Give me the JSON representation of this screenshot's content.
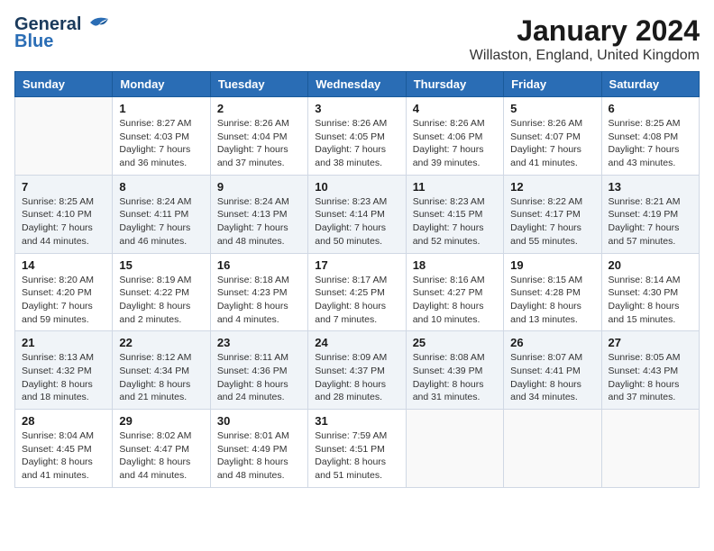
{
  "logo": {
    "line1": "General",
    "line2": "Blue"
  },
  "title": "January 2024",
  "location": "Willaston, England, United Kingdom",
  "days_of_week": [
    "Sunday",
    "Monday",
    "Tuesday",
    "Wednesday",
    "Thursday",
    "Friday",
    "Saturday"
  ],
  "weeks": [
    [
      {
        "day": "",
        "info": ""
      },
      {
        "day": "1",
        "info": "Sunrise: 8:27 AM\nSunset: 4:03 PM\nDaylight: 7 hours\nand 36 minutes."
      },
      {
        "day": "2",
        "info": "Sunrise: 8:26 AM\nSunset: 4:04 PM\nDaylight: 7 hours\nand 37 minutes."
      },
      {
        "day": "3",
        "info": "Sunrise: 8:26 AM\nSunset: 4:05 PM\nDaylight: 7 hours\nand 38 minutes."
      },
      {
        "day": "4",
        "info": "Sunrise: 8:26 AM\nSunset: 4:06 PM\nDaylight: 7 hours\nand 39 minutes."
      },
      {
        "day": "5",
        "info": "Sunrise: 8:26 AM\nSunset: 4:07 PM\nDaylight: 7 hours\nand 41 minutes."
      },
      {
        "day": "6",
        "info": "Sunrise: 8:25 AM\nSunset: 4:08 PM\nDaylight: 7 hours\nand 43 minutes."
      }
    ],
    [
      {
        "day": "7",
        "info": "Sunrise: 8:25 AM\nSunset: 4:10 PM\nDaylight: 7 hours\nand 44 minutes."
      },
      {
        "day": "8",
        "info": "Sunrise: 8:24 AM\nSunset: 4:11 PM\nDaylight: 7 hours\nand 46 minutes."
      },
      {
        "day": "9",
        "info": "Sunrise: 8:24 AM\nSunset: 4:13 PM\nDaylight: 7 hours\nand 48 minutes."
      },
      {
        "day": "10",
        "info": "Sunrise: 8:23 AM\nSunset: 4:14 PM\nDaylight: 7 hours\nand 50 minutes."
      },
      {
        "day": "11",
        "info": "Sunrise: 8:23 AM\nSunset: 4:15 PM\nDaylight: 7 hours\nand 52 minutes."
      },
      {
        "day": "12",
        "info": "Sunrise: 8:22 AM\nSunset: 4:17 PM\nDaylight: 7 hours\nand 55 minutes."
      },
      {
        "day": "13",
        "info": "Sunrise: 8:21 AM\nSunset: 4:19 PM\nDaylight: 7 hours\nand 57 minutes."
      }
    ],
    [
      {
        "day": "14",
        "info": "Sunrise: 8:20 AM\nSunset: 4:20 PM\nDaylight: 7 hours\nand 59 minutes."
      },
      {
        "day": "15",
        "info": "Sunrise: 8:19 AM\nSunset: 4:22 PM\nDaylight: 8 hours\nand 2 minutes."
      },
      {
        "day": "16",
        "info": "Sunrise: 8:18 AM\nSunset: 4:23 PM\nDaylight: 8 hours\nand 4 minutes."
      },
      {
        "day": "17",
        "info": "Sunrise: 8:17 AM\nSunset: 4:25 PM\nDaylight: 8 hours\nand 7 minutes."
      },
      {
        "day": "18",
        "info": "Sunrise: 8:16 AM\nSunset: 4:27 PM\nDaylight: 8 hours\nand 10 minutes."
      },
      {
        "day": "19",
        "info": "Sunrise: 8:15 AM\nSunset: 4:28 PM\nDaylight: 8 hours\nand 13 minutes."
      },
      {
        "day": "20",
        "info": "Sunrise: 8:14 AM\nSunset: 4:30 PM\nDaylight: 8 hours\nand 15 minutes."
      }
    ],
    [
      {
        "day": "21",
        "info": "Sunrise: 8:13 AM\nSunset: 4:32 PM\nDaylight: 8 hours\nand 18 minutes."
      },
      {
        "day": "22",
        "info": "Sunrise: 8:12 AM\nSunset: 4:34 PM\nDaylight: 8 hours\nand 21 minutes."
      },
      {
        "day": "23",
        "info": "Sunrise: 8:11 AM\nSunset: 4:36 PM\nDaylight: 8 hours\nand 24 minutes."
      },
      {
        "day": "24",
        "info": "Sunrise: 8:09 AM\nSunset: 4:37 PM\nDaylight: 8 hours\nand 28 minutes."
      },
      {
        "day": "25",
        "info": "Sunrise: 8:08 AM\nSunset: 4:39 PM\nDaylight: 8 hours\nand 31 minutes."
      },
      {
        "day": "26",
        "info": "Sunrise: 8:07 AM\nSunset: 4:41 PM\nDaylight: 8 hours\nand 34 minutes."
      },
      {
        "day": "27",
        "info": "Sunrise: 8:05 AM\nSunset: 4:43 PM\nDaylight: 8 hours\nand 37 minutes."
      }
    ],
    [
      {
        "day": "28",
        "info": "Sunrise: 8:04 AM\nSunset: 4:45 PM\nDaylight: 8 hours\nand 41 minutes."
      },
      {
        "day": "29",
        "info": "Sunrise: 8:02 AM\nSunset: 4:47 PM\nDaylight: 8 hours\nand 44 minutes."
      },
      {
        "day": "30",
        "info": "Sunrise: 8:01 AM\nSunset: 4:49 PM\nDaylight: 8 hours\nand 48 minutes."
      },
      {
        "day": "31",
        "info": "Sunrise: 7:59 AM\nSunset: 4:51 PM\nDaylight: 8 hours\nand 51 minutes."
      },
      {
        "day": "",
        "info": ""
      },
      {
        "day": "",
        "info": ""
      },
      {
        "day": "",
        "info": ""
      }
    ]
  ]
}
